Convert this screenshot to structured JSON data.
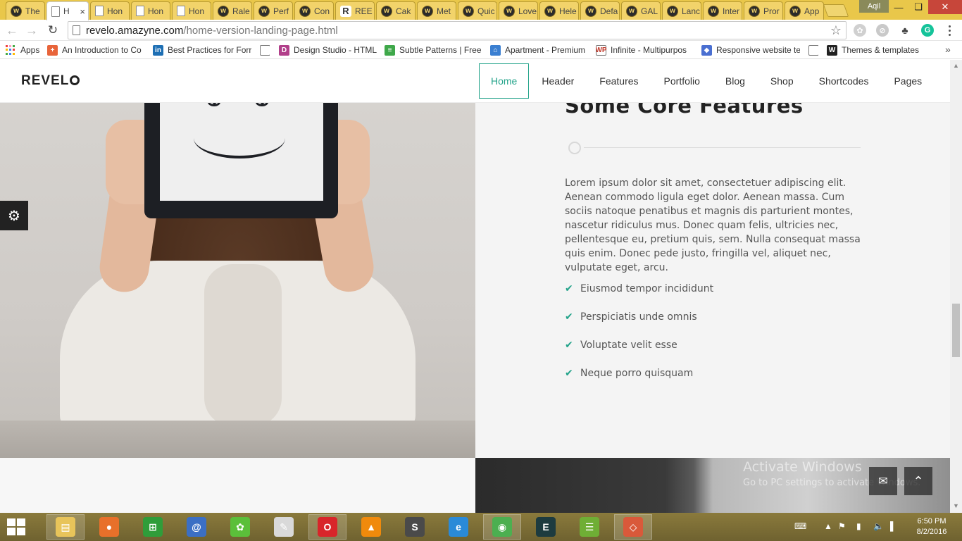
{
  "browser": {
    "tabs": [
      {
        "title": "The",
        "favicon": "w-icon"
      },
      {
        "title": "H",
        "favicon": "doc-icon",
        "active": true
      },
      {
        "title": "Hon",
        "favicon": "doc-icon"
      },
      {
        "title": "Hon",
        "favicon": "doc-icon"
      },
      {
        "title": "Hon",
        "favicon": "doc-icon"
      },
      {
        "title": "Rale",
        "favicon": "w-icon"
      },
      {
        "title": "Perf",
        "favicon": "w-icon"
      },
      {
        "title": "Con",
        "favicon": "w-icon"
      },
      {
        "title": "REE",
        "favicon": "r-icon"
      },
      {
        "title": "Cak",
        "favicon": "w-icon"
      },
      {
        "title": "Met",
        "favicon": "w-icon"
      },
      {
        "title": "Quic",
        "favicon": "w-icon"
      },
      {
        "title": "Love",
        "favicon": "w-icon"
      },
      {
        "title": "Hele",
        "favicon": "w-icon"
      },
      {
        "title": "Defa",
        "favicon": "w-icon"
      },
      {
        "title": "GAL",
        "favicon": "w-icon"
      },
      {
        "title": "Lanc",
        "favicon": "w-icon"
      },
      {
        "title": "Inter",
        "favicon": "w-icon"
      },
      {
        "title": "Pror",
        "favicon": "w-icon"
      },
      {
        "title": "App",
        "favicon": "w-icon"
      }
    ],
    "profile_name": "Aqil",
    "url_domain": "revelo.amazyne.com",
    "url_path": "/home-version-landing-page.html",
    "bookmarks": [
      {
        "label": "Apps",
        "icon": "apps-grid-icon"
      },
      {
        "label": "An Introduction to Co",
        "icon": "plus-icon"
      },
      {
        "label": "Best Practices for Forr",
        "icon": "linkedin-icon"
      },
      {
        "label": "",
        "icon": "doc-icon"
      },
      {
        "label": "Design Studio - HTML",
        "icon": "d-icon"
      },
      {
        "label": "Subtle Patterns | Free",
        "icon": "pattern-icon"
      },
      {
        "label": "Apartment - Premium",
        "icon": "house-icon"
      },
      {
        "label": "Infinite - Multipurpos",
        "icon": "wp-icon"
      },
      {
        "label": "Responsive website te",
        "icon": "shield-icon"
      },
      {
        "label": "",
        "icon": "doc-icon"
      },
      {
        "label": "Themes & templates",
        "icon": "w-icon"
      }
    ]
  },
  "site": {
    "logo": "REVEL",
    "nav": [
      "Home",
      "Header",
      "Features",
      "Portfolio",
      "Blog",
      "Shop",
      "Shortcodes",
      "Pages"
    ],
    "active_nav": "Home",
    "accent_color": "#23a38a",
    "features": {
      "title": "Some Core Features",
      "body": "Lorem ipsum dolor sit amet, consectetuer adipiscing elit. Aenean commodo ligula eget dolor. Aenean massa. Cum sociis natoque penatibus et magnis dis parturient montes, nascetur ridiculus mus. Donec quam felis, ultricies nec, pellentesque eu, pretium quis, sem. Nulla consequat massa quis enim. Donec pede justo, fringilla vel, aliquet nec, vulputate eget, arcu.",
      "items": [
        "Eiusmod tempor incididunt",
        "Perspiciatis unde omnis",
        "Voluptate velit esse",
        "Neque porro quisquam"
      ]
    },
    "watermark_title": "Activate Windows",
    "watermark_sub": "Go to PC settings to activate Windows."
  },
  "taskbar": {
    "apps": [
      "file-explorer-icon",
      "firefox-icon",
      "store-icon",
      "mail-icon",
      "frog-icon",
      "paint-icon",
      "opera-icon",
      "vlc-icon",
      "sublime-icon",
      "ie-icon",
      "chrome-icon",
      "editor-icon",
      "stack-icon",
      "git-icon"
    ],
    "time": "6:50 PM",
    "date": "8/2/2016"
  }
}
